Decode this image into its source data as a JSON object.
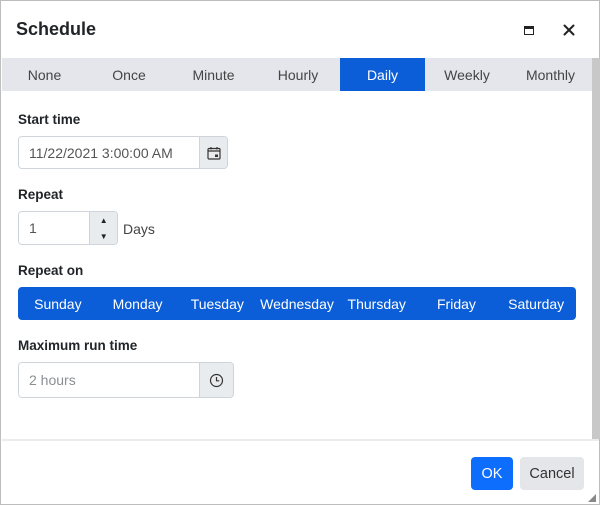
{
  "dialog": {
    "title": "Schedule",
    "maximize_icon": "maximize-icon",
    "close_icon": "close-icon"
  },
  "tabs": [
    {
      "label": "None",
      "active": false
    },
    {
      "label": "Once",
      "active": false
    },
    {
      "label": "Minute",
      "active": false
    },
    {
      "label": "Hourly",
      "active": false
    },
    {
      "label": "Daily",
      "active": true
    },
    {
      "label": "Weekly",
      "active": false
    },
    {
      "label": "Monthly",
      "active": false
    }
  ],
  "form": {
    "start_time": {
      "label": "Start time",
      "value": "11/22/2021 3:00:00 AM",
      "icon": "calendar-icon"
    },
    "repeat": {
      "label": "Repeat",
      "value": "1",
      "unit": "Days",
      "up_icon": "caret-up-icon",
      "down_icon": "caret-down-icon"
    },
    "repeat_on": {
      "label": "Repeat on",
      "days": [
        {
          "label": "Sunday",
          "selected": true
        },
        {
          "label": "Monday",
          "selected": true
        },
        {
          "label": "Tuesday",
          "selected": true
        },
        {
          "label": "Wednesday",
          "selected": true
        },
        {
          "label": "Thursday",
          "selected": true
        },
        {
          "label": "Friday",
          "selected": true
        },
        {
          "label": "Saturday",
          "selected": true
        }
      ]
    },
    "max_run_time": {
      "label": "Maximum run time",
      "placeholder": "2 hours",
      "icon": "clock-icon"
    }
  },
  "footer": {
    "ok_label": "OK",
    "cancel_label": "Cancel"
  },
  "colors": {
    "accent": "#0b5ed7",
    "primary_button": "#0d6efd",
    "tab_bar": "#e4e6eb",
    "secondary_button": "#e4e6ea"
  }
}
